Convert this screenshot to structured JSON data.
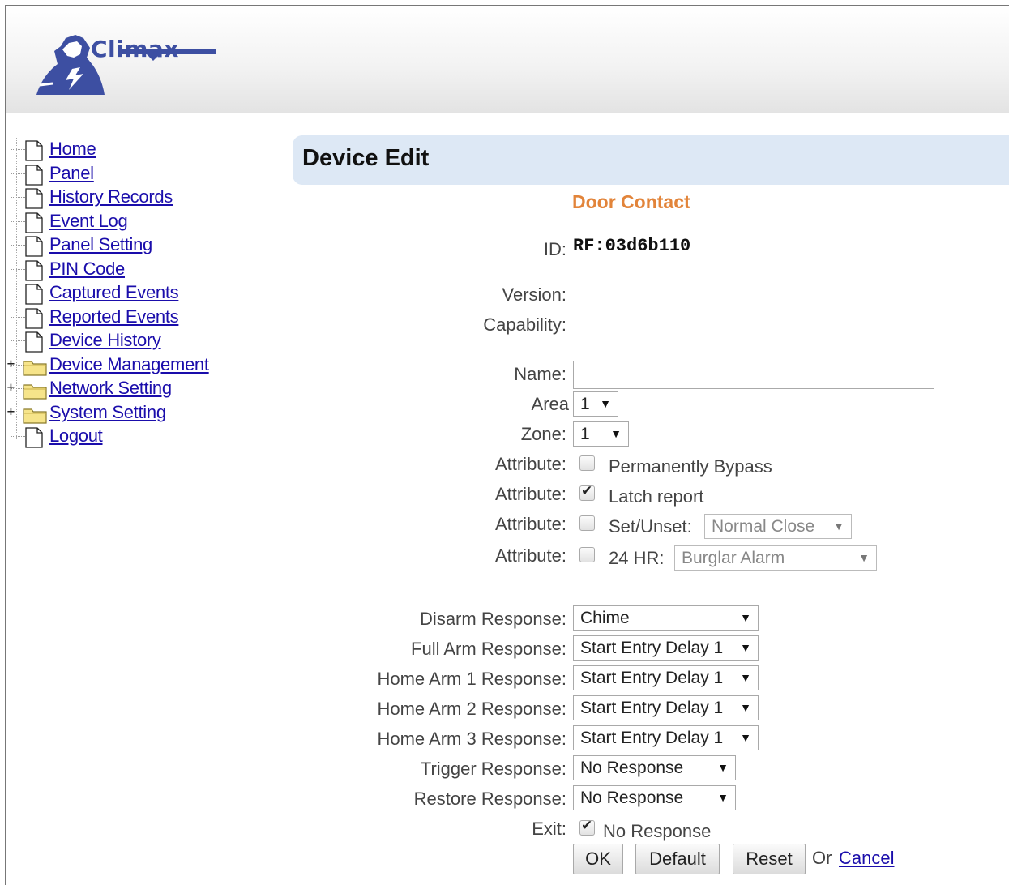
{
  "brand": {
    "name": "Climax"
  },
  "sidebar": {
    "items": [
      {
        "label": "Home",
        "type": "page"
      },
      {
        "label": "Panel",
        "type": "page"
      },
      {
        "label": "History Records",
        "type": "page"
      },
      {
        "label": "Event Log",
        "type": "page"
      },
      {
        "label": "Panel Setting",
        "type": "page"
      },
      {
        "label": "PIN Code",
        "type": "page"
      },
      {
        "label": "Captured Events",
        "type": "page"
      },
      {
        "label": "Reported Events",
        "type": "page"
      },
      {
        "label": "Device History",
        "type": "page"
      },
      {
        "label": "Device Management",
        "type": "folder",
        "expander": "+"
      },
      {
        "label": "Network Setting",
        "type": "folder",
        "expander": "+"
      },
      {
        "label": "System Setting",
        "type": "folder",
        "expander": "+"
      },
      {
        "label": "Logout",
        "type": "page"
      }
    ]
  },
  "main": {
    "title": "Device Edit",
    "device_type": "Door Contact",
    "id_label": "ID:",
    "id_value": "RF:03d6b110",
    "version_label": "Version:",
    "capability_label": "Capability:",
    "name_label": "Name:",
    "name_value": "",
    "area_label": "Area",
    "area_value": "1",
    "zone_label": "Zone:",
    "zone_value": "1",
    "attributes": {
      "label": "Attribute:",
      "permanently_bypass": {
        "text": "Permanently Bypass",
        "checked": false
      },
      "latch_report": {
        "text": "Latch report",
        "checked": true
      },
      "set_unset": {
        "text": "Set/Unset:",
        "checked": false,
        "select_value": "Normal Close"
      },
      "hr24": {
        "text": "24 HR:",
        "checked": false,
        "select_value": "Burglar Alarm"
      }
    },
    "responses": {
      "disarm_label": "Disarm Response:",
      "disarm_value": "Chime",
      "full_arm_label": "Full Arm Response:",
      "full_arm_value": "Start Entry Delay 1",
      "home_arm1_label": "Home Arm 1 Response:",
      "home_arm1_value": "Start Entry Delay 1",
      "home_arm2_label": "Home Arm 2 Response:",
      "home_arm2_value": "Start Entry Delay 1",
      "home_arm3_label": "Home Arm 3 Response:",
      "home_arm3_value": "Start Entry Delay 1",
      "trigger_label": "Trigger Response:",
      "trigger_value": "No Response",
      "restore_label": "Restore Response:",
      "restore_value": "No Response",
      "exit_label": "Exit:",
      "exit_text": "No Response",
      "exit_checked": true
    },
    "buttons": {
      "ok": "OK",
      "default": "Default",
      "reset": "Reset",
      "or": "Or",
      "cancel": "Cancel"
    }
  },
  "colors": {
    "accent": "#e2843a",
    "title_bar": "#dde8f5",
    "link": "#1a0dab",
    "brand": "#3d4fa2"
  }
}
